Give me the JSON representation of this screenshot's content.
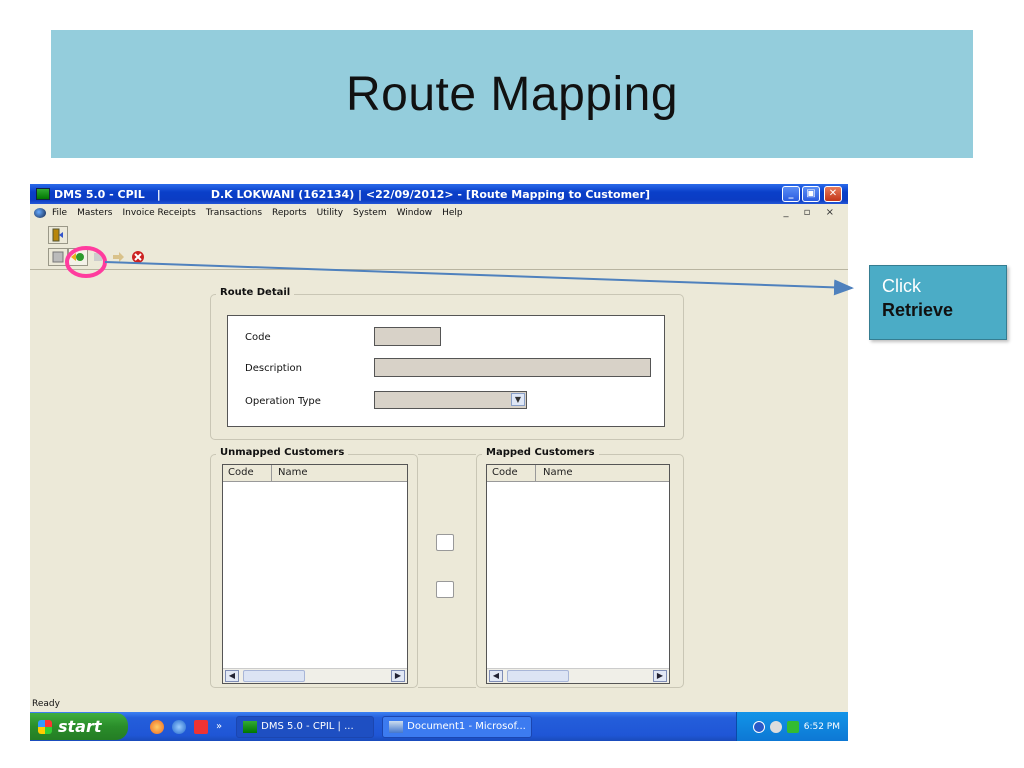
{
  "slide": {
    "title": "Route Mapping"
  },
  "window": {
    "app": "DMS 5.0 - CPIL",
    "separator": "|",
    "caption": "D.K LOKWANI (162134)  |  <22/09/2012>  - [Route Mapping to Customer]",
    "controls": {
      "minimize": "_",
      "maximize": "▣",
      "close": "✕"
    },
    "mdi_controls": "_ ▫ ×"
  },
  "menu": {
    "items": [
      "File",
      "Masters",
      "Invoice Receipts",
      "Transactions",
      "Reports",
      "Utility",
      "System",
      "Window",
      "Help"
    ]
  },
  "form": {
    "route_detail": {
      "title": "Route Detail",
      "code_label": "Code",
      "description_label": "Description",
      "operation_type_label": "Operation Type",
      "code_value": "",
      "description_value": "",
      "operation_type_value": ""
    },
    "unmapped": {
      "title": "Unmapped Customers",
      "columns": [
        "Code",
        "Name"
      ]
    },
    "mapped": {
      "title": "Mapped Customers",
      "columns": [
        "Code",
        "Name"
      ]
    }
  },
  "status": {
    "text": "Ready"
  },
  "taskbar": {
    "start_label": "start",
    "more_glyph": "»",
    "tasks": [
      "DMS 5.0 - CPIL  |  ...",
      "Document1 - Microsof..."
    ],
    "clock": "6:52 PM"
  },
  "callout": {
    "line1": "Click",
    "line2": "Retrieve"
  },
  "colors": {
    "banner": "#94cddc",
    "callout": "#4bacc6",
    "highlight_ring": "#ff3c9e",
    "arrow": "#4f81bd"
  }
}
